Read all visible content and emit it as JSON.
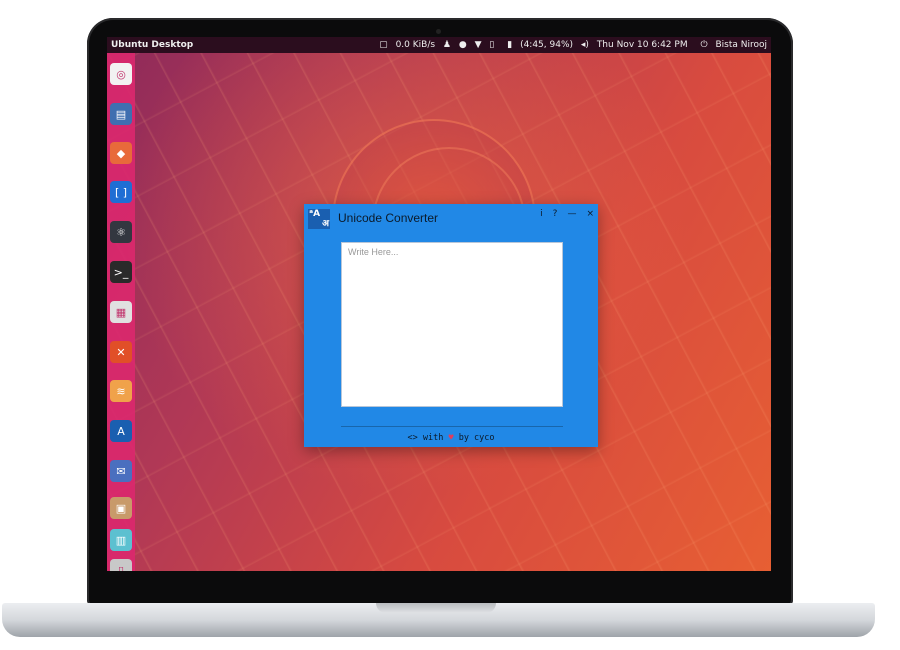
{
  "top_panel": {
    "title": "Ubuntu Desktop",
    "network": "0.0 KiB/s",
    "battery": "(4:45, 94%)",
    "clock": "Thu Nov 10  6:42 PM",
    "user": "Bista Nirooj"
  },
  "launcher": {
    "items": [
      {
        "name": "ubuntu-dash",
        "icon": "ubuntu-logo-icon",
        "color": "#f2f2f2"
      },
      {
        "name": "files",
        "icon": "folder-icon",
        "color": "#3f6fb0"
      },
      {
        "name": "gitkraken",
        "icon": "fox-icon",
        "color": "#e86a3a"
      },
      {
        "name": "brackets",
        "icon": "brackets-icon",
        "color": "#1f6ed4"
      },
      {
        "name": "atom",
        "icon": "atom-icon",
        "color": "#333740"
      },
      {
        "name": "terminal",
        "icon": "terminal-icon",
        "color": "#2a2a2a"
      },
      {
        "name": "document-editor",
        "icon": "document-icon",
        "color": "#e0e0e0"
      },
      {
        "name": "app-store",
        "icon": "tools-icon",
        "color": "#e14f28"
      },
      {
        "name": "sublime",
        "icon": "cake-icon",
        "color": "#f0a24a"
      },
      {
        "name": "unicode-converter",
        "icon": "unicode-converter-icon",
        "color": "#1a5fb0"
      },
      {
        "name": "thunderbird",
        "icon": "mail-icon",
        "color": "#4a6fbf"
      },
      {
        "name": "archive-manager",
        "icon": "archive-icon",
        "color": "#c89a6a"
      },
      {
        "name": "software-center",
        "icon": "shopping-bag-icon",
        "color": "#5cc0d0"
      },
      {
        "name": "trash",
        "icon": "trash-icon",
        "color": "#c8c8c8"
      }
    ]
  },
  "window": {
    "app_icon_text": "ᵃA\n  अ",
    "title": "Unicode Converter",
    "info_label": "i",
    "help_label": "?",
    "minimize_label": "—",
    "close_label": "×",
    "input": {
      "placeholder": "Write Here...",
      "value": ""
    },
    "footer": {
      "code": "<>",
      "with": "with",
      "heart": "♥",
      "by": "by cyco"
    }
  }
}
